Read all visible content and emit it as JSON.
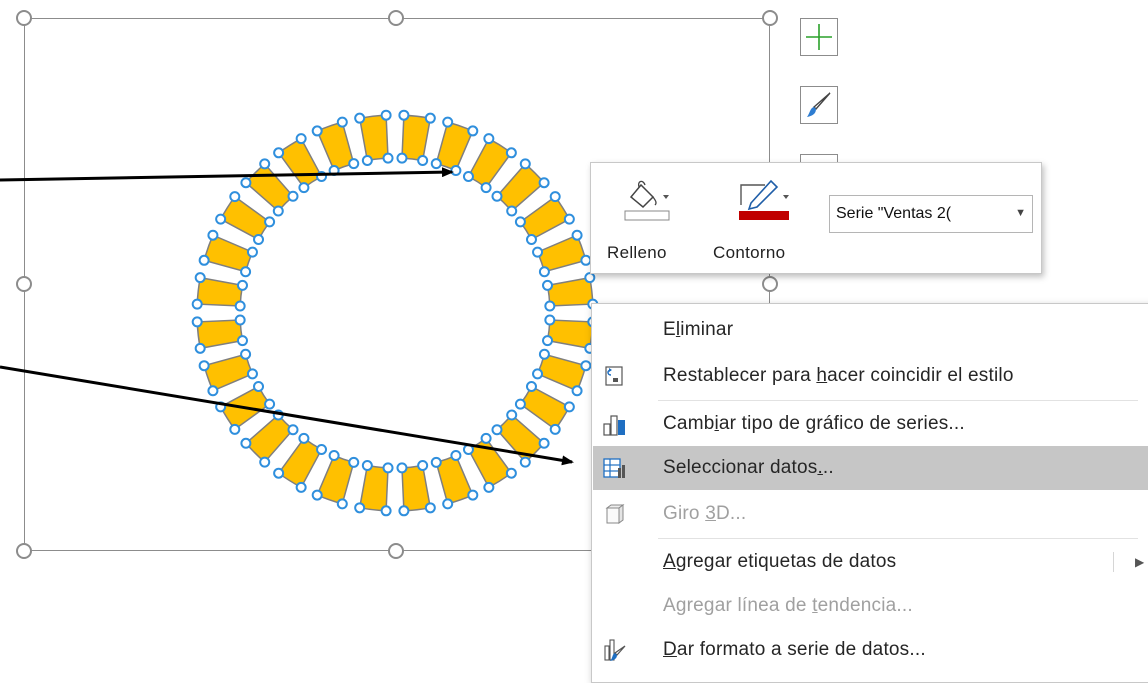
{
  "toolbar": {
    "fill_label": "Relleno",
    "outline_label": "Contorno",
    "series_selector_value": "Serie \"Ventas 2(",
    "outline_color": "#c00000"
  },
  "side_buttons": [
    "add-chart-element",
    "chart-styles",
    "chart-filters"
  ],
  "context_menu": {
    "items": [
      {
        "label_parts": [
          "E",
          "l",
          "iminar"
        ],
        "disabled": false
      },
      {
        "label_parts": [
          "Restablecer para ",
          "h",
          "acer coincidir el estilo"
        ],
        "disabled": false
      },
      {
        "label_parts": [
          "Camb",
          "i",
          "ar tipo de gráfico de series..."
        ],
        "disabled": false
      },
      {
        "label_parts": [
          "Seleccionar datos",
          ".",
          ".."
        ],
        "disabled": false,
        "selected": true
      },
      {
        "label_parts": [
          "Giro ",
          "3",
          "D..."
        ],
        "disabled": true
      },
      {
        "label_parts": [
          "",
          "A",
          "gregar etiquetas de datos"
        ],
        "disabled": false,
        "has_submenu": true
      },
      {
        "label_parts": [
          "Agregar línea de ",
          "t",
          "endencia..."
        ],
        "disabled": true
      },
      {
        "label_parts": [
          "",
          "D",
          "ar formato a serie de datos..."
        ],
        "disabled": false
      }
    ]
  },
  "chart_data": {
    "type": "doughnut",
    "segments": 28,
    "segment_color": "#ffc000",
    "selection_color": "#2f8fdd"
  },
  "colors": {
    "frame": "#8c8c8c",
    "menu_highlight": "#c6c6c6",
    "arrow": "#000000"
  }
}
